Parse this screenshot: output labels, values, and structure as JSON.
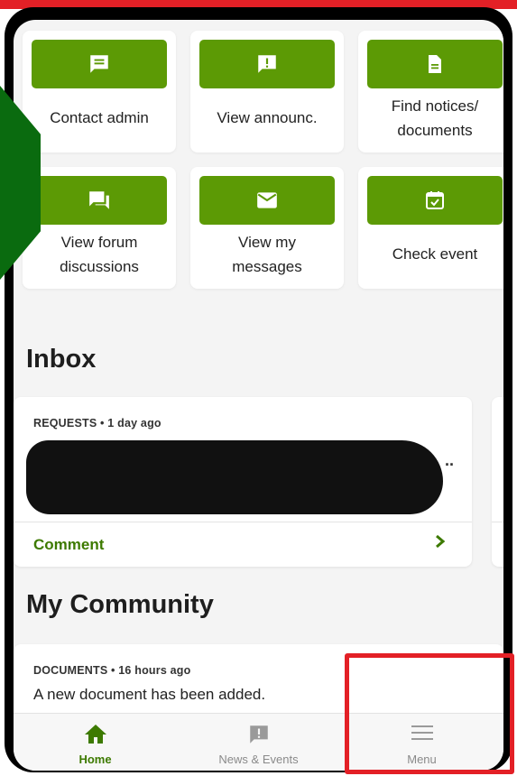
{
  "tiles": [
    {
      "label": "Contact admin",
      "icon": "message-square-icon"
    },
    {
      "label": "View announc.",
      "icon": "alert-message-icon"
    },
    {
      "label": "Find notices/ documents",
      "icon": "document-icon"
    },
    {
      "label": "View forum discussions",
      "icon": "forum-icon"
    },
    {
      "label": "View my messages",
      "icon": "envelope-icon"
    },
    {
      "label": "Check event",
      "icon": "calendar-check-icon"
    }
  ],
  "inbox": {
    "title": "Inbox",
    "card": {
      "category": "REQUESTS",
      "time": "1 day ago",
      "meta": "REQUESTS • 1 day ago",
      "ellipsis": "..",
      "action": "Comment"
    }
  },
  "community": {
    "title": "My Community",
    "card": {
      "meta": "DOCUMENTS • 16 hours ago",
      "text": "A new document has been added."
    }
  },
  "tabbar": {
    "items": [
      {
        "label": "Home",
        "icon": "home-icon",
        "active": true
      },
      {
        "label": "News & Events",
        "icon": "news-alert-icon",
        "active": false
      },
      {
        "label": "Menu",
        "icon": "hamburger-menu-icon",
        "active": false
      }
    ]
  },
  "colors": {
    "accent": "#5c9a05",
    "accent_dark": "#3d7a00",
    "highlight": "#e32026",
    "side_shape": "#0a6b0f"
  }
}
